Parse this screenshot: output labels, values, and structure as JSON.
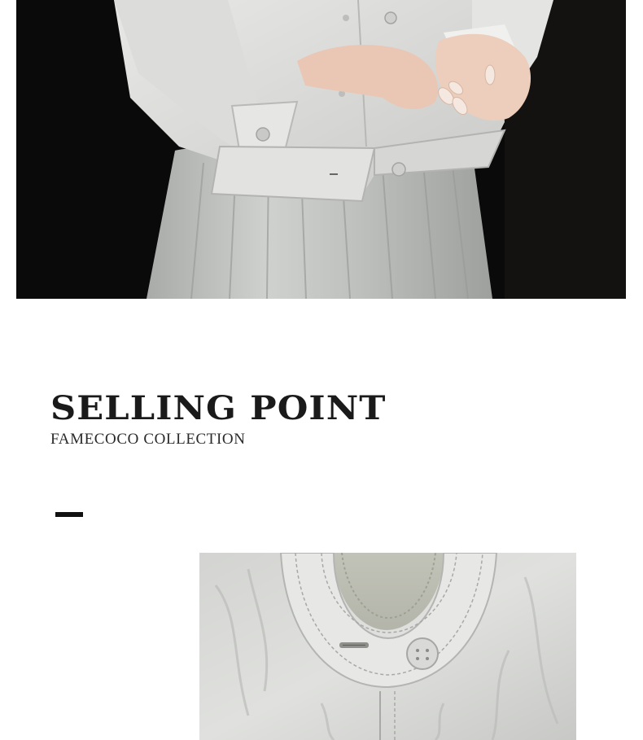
{
  "hero_photo": {
    "subject": "model-wearing-jacket-and-skirt",
    "icon": "photo-icon"
  },
  "selling_point": {
    "title": "SELLING POINT",
    "subtitle": "FAMECOCO COLLECTION"
  },
  "detail_photo": {
    "subject": "collar-button-detail",
    "icon": "photo-icon"
  },
  "colors": {
    "background": "#ffffff",
    "text": "#1a1a1a",
    "accent_bar": "#111111",
    "backdrop": "#0b0b0b",
    "fabric": "#d7d7d4"
  }
}
